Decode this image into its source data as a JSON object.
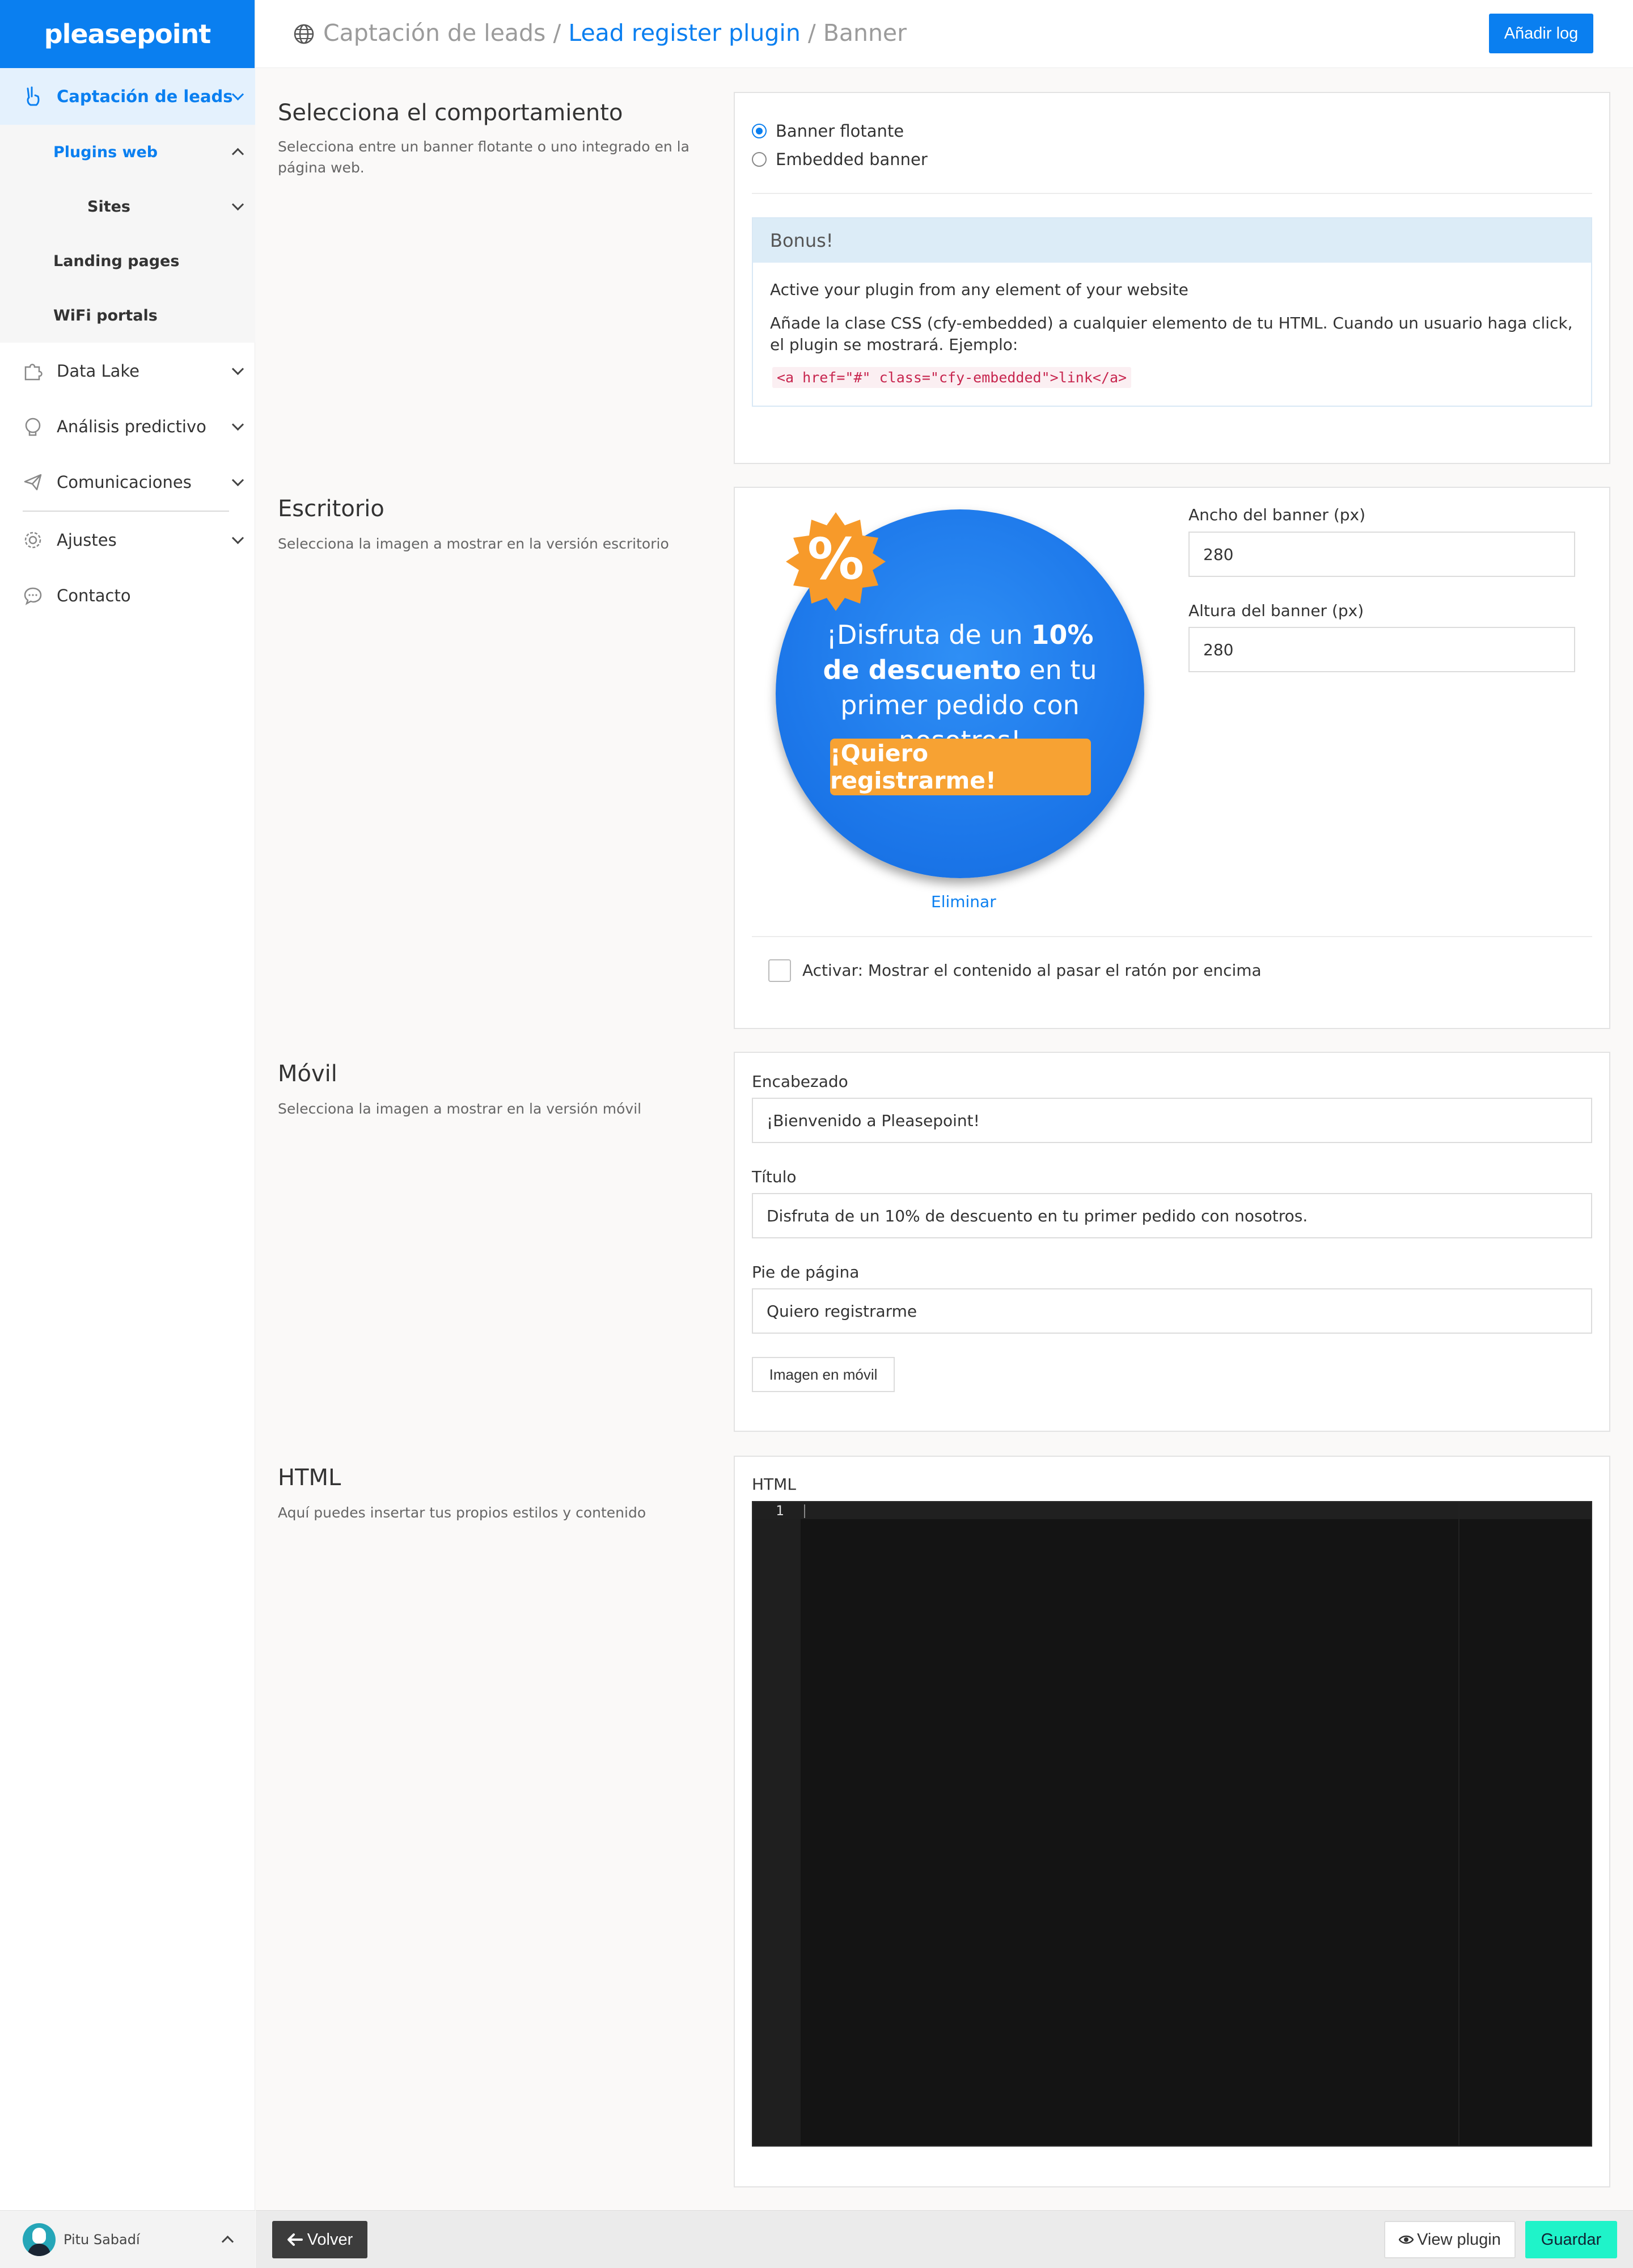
{
  "app": {
    "logo": "pleasepoint"
  },
  "sidebar": {
    "items": [
      {
        "label": "Captación de leads",
        "icon": "hand-peace-icon"
      },
      {
        "label": "Data Lake",
        "icon": "puzzle-icon"
      },
      {
        "label": "Análisis predictivo",
        "icon": "brain-icon"
      },
      {
        "label": "Comunicaciones",
        "icon": "paper-plane-icon"
      },
      {
        "label": "Ajustes",
        "icon": "gear-icon"
      },
      {
        "label": "Contacto",
        "icon": "chat-icon"
      }
    ],
    "subitems": [
      {
        "label": "Plugins web"
      },
      {
        "label": "Sites"
      },
      {
        "label": "Landing pages"
      },
      {
        "label": "WiFi portals"
      }
    ],
    "user": {
      "name": "Pitu Sabadí"
    }
  },
  "header": {
    "breadcrumb": {
      "first": "Captación de leads",
      "sep1": " / ",
      "second": "Lead register plugin",
      "sep2": " / ",
      "third": "Banner"
    },
    "add_log_label": "Añadir log"
  },
  "behavior": {
    "title": "Selecciona el comportamiento",
    "description": "Selecciona entre un banner flotante o uno integrado en la página web.",
    "options": [
      {
        "label": "Banner flotante",
        "checked": true
      },
      {
        "label": "Embedded banner",
        "checked": false
      }
    ],
    "bonus": {
      "title": "Bonus!",
      "line1": "Active your plugin from any element of your website",
      "line2": "Añade la clase CSS (cfy-embedded) a cualquier elemento de tu HTML. Cuando un usuario haga click, el plugin se mostrará. Ejemplo:",
      "code": "<a href=\"#\" class=\"cfy-embedded\">link</a>"
    }
  },
  "desktop": {
    "title": "Escritorio",
    "description": "Selecciona la imagen a mostrar en la versión escritorio",
    "banner": {
      "text_pre": "¡Disfruta de un ",
      "text_bold1": "10% de descuento",
      "text_post": " en tu primer pedido con nosotros!",
      "cta": "¡Quiero registrarme!",
      "badge": "%"
    },
    "delete_label": "Eliminar",
    "width_label": "Ancho del banner (px)",
    "width_value": "280",
    "height_label": "Altura del banner (px)",
    "height_value": "280",
    "hover_label": "Activar: Mostrar el contenido al pasar el ratón por encima",
    "hover_checked": false
  },
  "mobile": {
    "title": "Móvil",
    "description": "Selecciona la imagen a mostrar en la versión móvil",
    "header_label": "Encabezado",
    "header_value": "¡Bienvenido a Pleasepoint!",
    "title_label": "Título",
    "title_value": "Disfruta de un 10% de descuento en tu primer pedido con nosotros.",
    "footer_label": "Pie de página",
    "footer_value": "Quiero registrarme",
    "image_button": "Imagen en móvil"
  },
  "html_section": {
    "title": "HTML",
    "description": "Aquí puedes insertar tus propios estilos y contenido",
    "editor_label": "HTML",
    "line_number": "1"
  },
  "footer": {
    "back_label": "Volver",
    "view_plugin_label": "View plugin",
    "save_label": "Guardar"
  },
  "colors": {
    "primary": "#0a7ff0",
    "save": "#1ff3c9",
    "banner_cta": "#f7a233",
    "badge": "#f79a2a"
  }
}
